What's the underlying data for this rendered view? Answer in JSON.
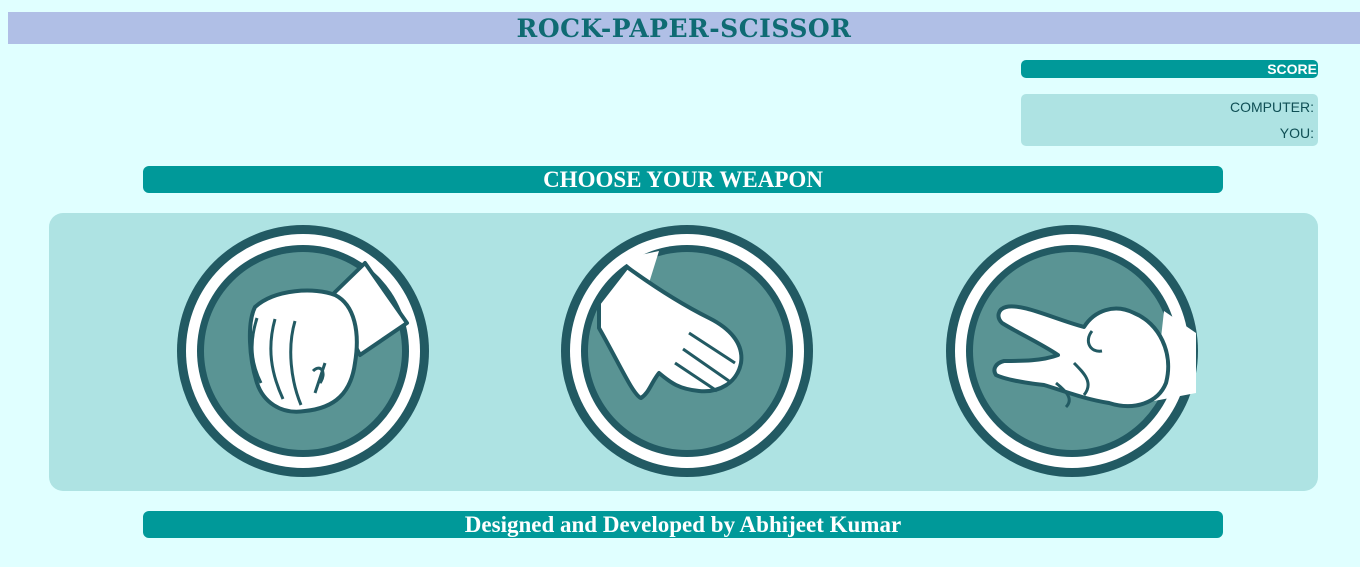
{
  "header": {
    "title": "ROCK-PAPER-SCISSOR"
  },
  "score": {
    "heading": "SCORE",
    "computer_label": "COMPUTER:",
    "you_label": "YOU:"
  },
  "prompt": {
    "text": "CHOOSE YOUR WEAPON"
  },
  "weapons": [
    {
      "name": "rock",
      "icon": "rock-fist-icon"
    },
    {
      "name": "paper",
      "icon": "paper-hand-icon"
    },
    {
      "name": "scissor",
      "icon": "scissor-hand-icon"
    }
  ],
  "footer": {
    "credit": "Designed and Developed by Abhijeet Kumar"
  },
  "colors": {
    "background": "#e0ffff",
    "title_bar": "#b0bfe6",
    "accent": "#009999",
    "panel": "#aee3e3",
    "icon_dark": "#225a63",
    "icon_mid": "#5a9494"
  }
}
